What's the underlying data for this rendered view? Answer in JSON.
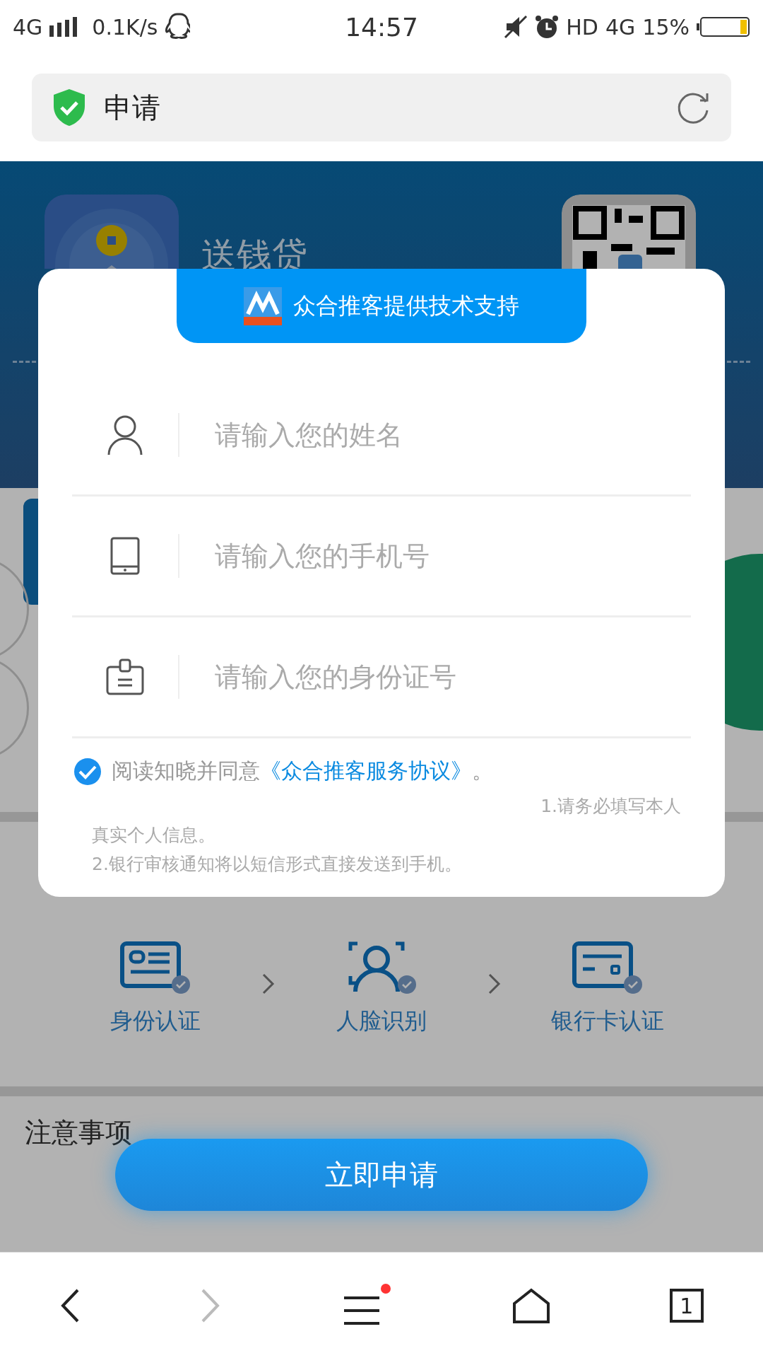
{
  "status_bar": {
    "network": "4G",
    "speed": "0.1K/s",
    "time": "14:57",
    "hd": "HD",
    "network_2": "4G",
    "battery": "15%"
  },
  "address_bar": {
    "title": "申请"
  },
  "page": {
    "app_name": "送钱贷",
    "steps": [
      {
        "label": "身份认证",
        "kind": "id"
      },
      {
        "label": "人脸识别",
        "kind": "face"
      },
      {
        "label": "银行卡认证",
        "kind": "card"
      }
    ],
    "notes_title": "注意事项",
    "apply_button": "立即申请"
  },
  "modal": {
    "banner": "众合推客提供技术支持",
    "fields": [
      {
        "placeholder": "请输入您的姓名",
        "kind": "person"
      },
      {
        "placeholder": "请输入您的手机号",
        "kind": "phone"
      },
      {
        "placeholder": "请输入您的身份证号",
        "kind": "id"
      }
    ],
    "agreement": {
      "checked": true,
      "text": "阅读知晓并同意",
      "link": "《众合推客服务协议》",
      "suffix": "。"
    },
    "notes": [
      "1.请务必填写本人",
      "真实个人信息。",
      "2.银行审核通知将以短信形式直接发送到手机。"
    ]
  },
  "bottom_nav": {
    "forward_disabled": true,
    "menu_notification": true,
    "tab_count": "1"
  }
}
